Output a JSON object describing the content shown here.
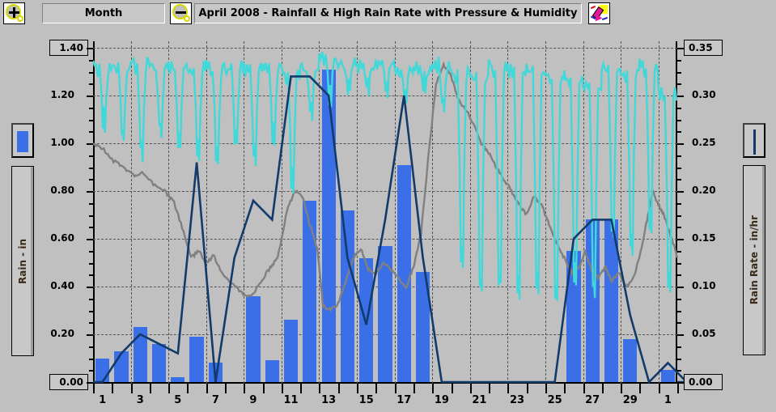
{
  "toolbar": {
    "zoom_in_icon": "magnifier-plus-icon",
    "zoom_out_icon": "magnifier-minus-icon",
    "edit_icon": "pencil-icon",
    "period_label": "Month",
    "title": "April 2008 - Rainfall & High Rain Rate with Pressure & Humidity"
  },
  "legend": {
    "left_swatch": "rain-bar-swatch",
    "right_swatch": "rain-rate-line-swatch"
  },
  "axes": {
    "left_title": "Rain - in",
    "right_title": "Rain Rate - in/hr"
  },
  "colors": {
    "rain_bar": "#3b6fe8",
    "rain_rate_line": "#123a6b",
    "humidity_line": "#40d8d8",
    "pressure_line": "#808080",
    "background": "#c0c0c0",
    "grid": "#555555"
  },
  "chart_data": {
    "type": "bar",
    "title": "April 2008 - Rainfall & High Rain Rate with Pressure & Humidity",
    "xlabel": "",
    "ylabel": "Rain - in",
    "y2label": "Rain Rate - in/hr",
    "ylim": [
      0.0,
      1.4
    ],
    "y2lim": [
      0.0,
      0.35
    ],
    "grid": true,
    "legend_position": "outside-left-and-right",
    "categories": [
      "1",
      "2",
      "3",
      "4",
      "5",
      "6",
      "7",
      "8",
      "9",
      "10",
      "11",
      "12",
      "13",
      "14",
      "15",
      "16",
      "17",
      "18",
      "19",
      "20",
      "21",
      "22",
      "23",
      "24",
      "25",
      "26",
      "27",
      "28",
      "29",
      "30",
      "1"
    ],
    "ytick_labels": [
      "0.00",
      "0.20",
      "0.40",
      "0.60",
      "0.80",
      "1.00",
      "1.20",
      "1.40"
    ],
    "ytick_values": [
      0.0,
      0.2,
      0.4,
      0.6,
      0.8,
      1.0,
      1.2,
      1.4
    ],
    "y2tick_labels": [
      "0.00",
      "0.05",
      "0.10",
      "0.15",
      "0.20",
      "0.25",
      "0.30",
      "0.35"
    ],
    "y2tick_values": [
      0.0,
      0.05,
      0.1,
      0.15,
      0.2,
      0.25,
      0.3,
      0.35
    ],
    "xtick_labels": [
      "1",
      "3",
      "5",
      "7",
      "9",
      "11",
      "13",
      "15",
      "17",
      "19",
      "21",
      "23",
      "25",
      "27",
      "29",
      "1"
    ],
    "series": [
      {
        "name": "Rain - in",
        "type": "bar",
        "axis": "left",
        "color": "#3b6fe8",
        "values": [
          0.1,
          0.13,
          0.23,
          0.16,
          0.02,
          0.19,
          0.08,
          0.0,
          0.36,
          0.09,
          0.26,
          0.76,
          1.31,
          0.72,
          0.52,
          0.57,
          0.91,
          0.46,
          0.0,
          0.0,
          0.0,
          0.0,
          0.0,
          0.0,
          0.0,
          0.55,
          0.68,
          0.68,
          0.18,
          0.0,
          0.05
        ]
      },
      {
        "name": "High Rain Rate - in/hr",
        "type": "line",
        "axis": "right",
        "color": "#123a6b",
        "values": [
          0.0,
          0.03,
          0.05,
          0.04,
          0.03,
          0.23,
          0.0,
          0.13,
          0.19,
          0.17,
          0.32,
          0.32,
          0.3,
          0.13,
          0.06,
          0.17,
          0.3,
          0.13,
          0.0,
          0.0,
          0.0,
          0.0,
          0.0,
          0.0,
          0.0,
          0.15,
          0.17,
          0.17,
          0.07,
          0.0,
          0.02,
          0.0
        ]
      },
      {
        "name": "Humidity",
        "type": "line",
        "axis": "none",
        "color": "#40d8d8",
        "note": "high-frequency oscillating trace across upper plot region"
      },
      {
        "name": "Pressure",
        "type": "line",
        "axis": "none",
        "color": "#808080",
        "note": "smooth slowly-varying trace across mid plot region"
      }
    ]
  }
}
